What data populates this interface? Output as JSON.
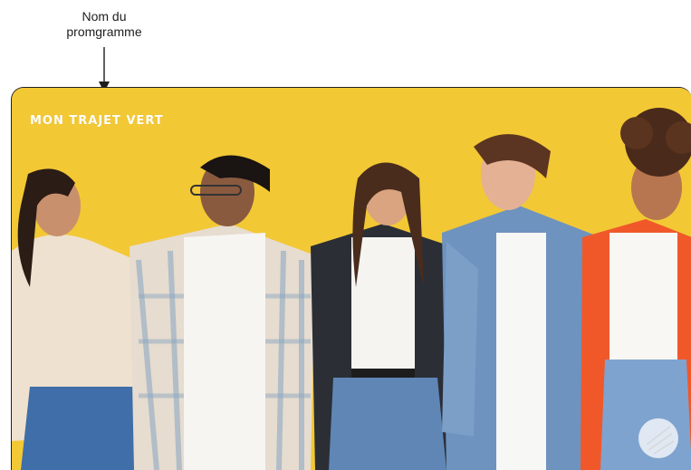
{
  "annotation": {
    "line1": "Nom du",
    "line2": "promgramme"
  },
  "card": {
    "program_name": "MON TRAJET VERT",
    "background_color": "#f1c52e",
    "image_icon": "group-photo-image",
    "badge_icon": "circle-badge-icon"
  }
}
